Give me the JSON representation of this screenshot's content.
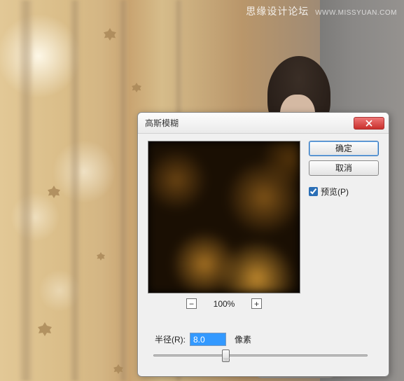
{
  "watermark": {
    "zh": "思缘设计论坛",
    "en": "WWW.MISSYUAN.COM"
  },
  "dialog": {
    "title": "高斯模糊",
    "buttons": {
      "ok": "确定",
      "cancel": "取消"
    },
    "preview_checkbox": {
      "label": "预览(P)",
      "checked": true
    },
    "zoom": {
      "value": "100%",
      "minus": "−",
      "plus": "+"
    },
    "radius": {
      "label": "半径(R):",
      "value": "8.0",
      "unit": "像素"
    }
  }
}
